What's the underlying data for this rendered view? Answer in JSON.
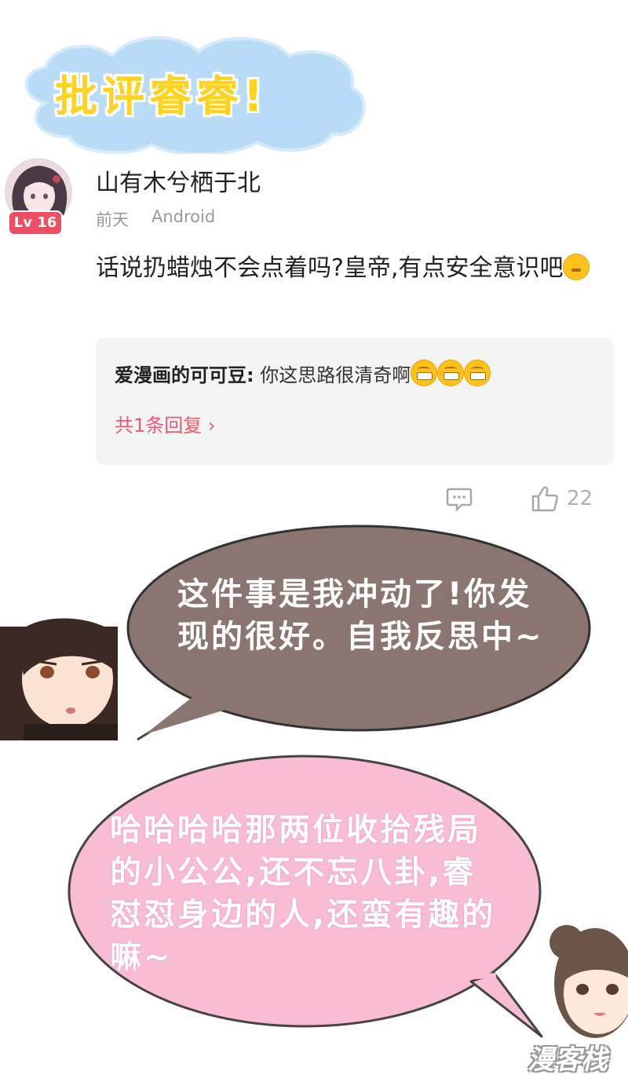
{
  "banner": {
    "title": "批评睿睿!"
  },
  "comment": {
    "username": "山有木兮栖于北",
    "level": "Lv 16",
    "time": "前天",
    "device": "Android",
    "text": "话说扔蜡烛不会点着吗?皇帝,有点安全意识吧",
    "reply": {
      "author": "爱漫画的可可豆:",
      "text": "你这思路很清奇啊",
      "count_label": "共1条回复"
    },
    "like_count": "22"
  },
  "comic": {
    "bubble_1": "这件事是我冲动了!你发现的很好。自我反思中~",
    "bubble_2": "哈哈哈哈那两位收拾残局的小公公,还不忘八卦,睿怼怼身边的人,还蛮有趣的嘛~",
    "watermark": "漫客栈"
  },
  "colors": {
    "cloud": "#b9dcf6",
    "title": "#ffd21f",
    "badge": "#ef4e62",
    "reply_link": "#ef5a6e",
    "bubble_brown": "#8b7570",
    "bubble_pink": "#f8bcd4"
  }
}
